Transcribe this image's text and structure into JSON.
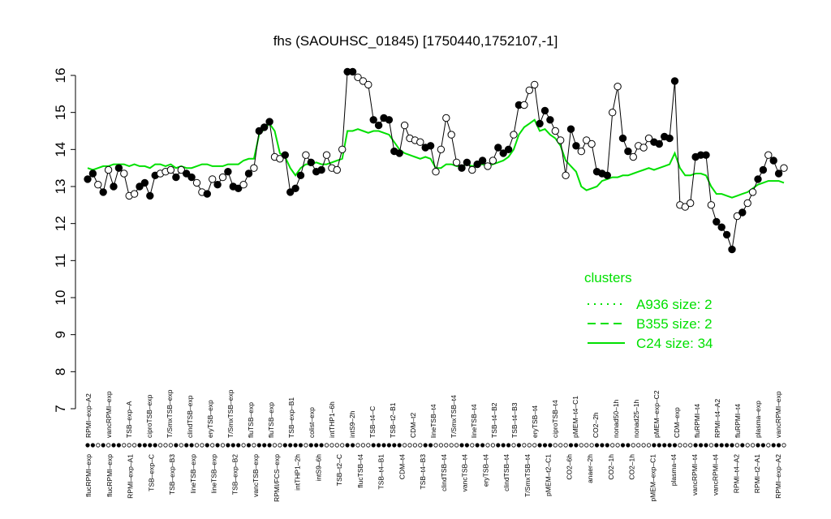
{
  "chart_data": {
    "type": "line",
    "title": "fhs (SAOUHSC_01845) [1750440,1752107,-1]",
    "xlabel": "",
    "ylabel": "",
    "ylim": [
      7,
      16
    ],
    "yticks": [
      7,
      8,
      9,
      10,
      11,
      12,
      13,
      14,
      15,
      16
    ],
    "x_labels_top": [
      "RPMI–exp–A2",
      "vancRPMI–exp",
      "TSB–exp–A",
      "ciproTSB–exp",
      "T/SmxTSB–exp",
      "clindTSB–exp",
      "eryTSB–exp",
      "T/SmxTSB–exp",
      "fluTSB–exp",
      "fluTSB–exp",
      "TSB–exp–B1",
      "colist–exp",
      "intTHP1–6h",
      "intS9–2h",
      "TSB–t4–C",
      "TSB–t2–B1",
      "CDM–t2",
      "lineTSB–t4",
      "T/SmxTSB–t4",
      "lineTSB–t4",
      "TSB–t4–B2",
      "TSB–t4–B3",
      "eryTSB–t4",
      "ciproTSB–t4",
      "pMEM–t4–C1",
      "CO2–2h",
      "nonad50–1h",
      "nonad25–1h",
      "pMEM–exp–C2",
      "CDM–exp",
      "fluRPMI–t4",
      "RPMI–t4–A2",
      "fluRPMI–t4",
      "plasma–exp",
      "vancRPMI–exp"
    ],
    "x_labels_bottom": [
      "flucRPMI–exp",
      "flucRPMI–exp",
      "RPMI–exp–A1",
      "TSB–exp–C",
      "TSB–exp–B3",
      "lineTSB–exp",
      "lineTSB–exp",
      "TSB–exp–B2",
      "vancTSB–exp",
      "RPMI/FCS–exp",
      "intTHP1–2h",
      "intS9–6h",
      "TSB–t2–C",
      "flucTSB–t4",
      "TSB–t4–B1",
      "CDM–t4",
      "TSB–t4–B3",
      "clindTSB–t4",
      "vancTSB–t4",
      "eryTSB–t4",
      "clindTSB–t4",
      "T/SmxTSB–t4",
      "pMEM–t2–C1",
      "CO2–6h",
      "anaer–2h",
      "CO2–1h",
      "CO2–1h",
      "pMEM–exp–C1",
      "plasma–t4",
      "vancRPMI–t4",
      "vancRPMI–t4",
      "RPMI–t4–A2",
      "RPMI–t2–A1",
      "RPMI–exp–A2"
    ],
    "values": [
      13.2,
      13.35,
      13.05,
      12.85,
      13.45,
      13.0,
      13.5,
      13.35,
      12.75,
      12.8,
      13.0,
      13.1,
      12.75,
      13.3,
      13.35,
      13.4,
      13.45,
      13.25,
      13.45,
      13.35,
      13.25,
      13.1,
      12.85,
      12.8,
      13.2,
      13.05,
      13.25,
      13.4,
      13.0,
      12.95,
      13.05,
      13.35,
      13.5,
      14.5,
      14.6,
      14.75,
      13.8,
      13.75,
      13.85,
      12.85,
      12.95,
      13.3,
      13.85,
      13.65,
      13.4,
      13.45,
      13.85,
      13.5,
      13.45,
      14.0,
      16.1,
      16.1,
      15.95,
      15.85,
      15.75,
      14.8,
      14.65,
      14.85,
      14.8,
      13.95,
      13.9,
      14.65,
      14.3,
      14.25,
      14.2,
      14.05,
      14.1,
      13.4,
      14.0,
      14.85,
      14.4,
      13.65,
      13.5,
      13.65,
      13.45,
      13.6,
      13.7,
      13.55,
      13.7,
      14.05,
      13.9,
      14.0,
      14.4,
      15.2,
      15.2,
      15.6,
      15.75,
      14.7,
      15.05,
      14.8,
      14.5,
      14.25,
      13.3,
      14.55,
      14.1,
      13.95,
      14.25,
      14.15,
      13.4,
      13.35,
      13.3,
      15.0,
      15.7,
      14.3,
      13.95,
      13.8,
      14.1,
      14.05,
      14.3,
      14.2,
      14.15,
      14.35,
      14.3,
      15.85,
      12.5,
      12.45,
      12.55,
      13.8,
      13.85,
      13.85,
      12.5,
      12.05,
      11.9,
      11.7,
      11.3,
      12.2,
      12.3,
      12.55,
      12.85,
      13.2,
      13.45,
      13.85,
      13.7,
      13.35,
      13.5
    ],
    "filled": [
      1,
      1,
      0,
      1,
      0,
      1,
      1,
      0,
      0,
      0,
      1,
      1,
      1,
      1,
      0,
      0,
      0,
      1,
      0,
      1,
      1,
      0,
      0,
      1,
      0,
      1,
      0,
      1,
      1,
      1,
      0,
      1,
      0,
      1,
      1,
      1,
      0,
      0,
      1,
      1,
      1,
      1,
      0,
      1,
      1,
      1,
      0,
      0,
      0,
      0,
      1,
      1,
      0,
      0,
      0,
      1,
      1,
      1,
      1,
      1,
      1,
      0,
      0,
      0,
      0,
      1,
      1,
      0,
      0,
      0,
      0,
      0,
      1,
      1,
      0,
      1,
      1,
      0,
      0,
      1,
      1,
      1,
      0,
      1,
      0,
      0,
      0,
      1,
      1,
      1,
      0,
      0,
      0,
      1,
      1,
      0,
      0,
      0,
      1,
      1,
      1,
      0,
      0,
      1,
      1,
      0,
      0,
      0,
      0,
      1,
      1,
      1,
      1,
      1,
      0,
      0,
      0,
      1,
      1,
      1,
      0,
      1,
      1,
      1,
      1,
      0,
      1,
      0,
      0,
      1,
      1,
      0,
      1,
      1,
      0
    ],
    "series": [
      {
        "name": "A936 size: 2",
        "style": "dotted"
      },
      {
        "name": "B355 size: 2",
        "style": "dashed"
      },
      {
        "name": "C24 size: 34",
        "style": "solid"
      }
    ],
    "cluster_line": [
      13.5,
      13.45,
      13.5,
      13.55,
      13.55,
      13.6,
      13.6,
      13.6,
      13.55,
      13.6,
      13.55,
      13.55,
      13.5,
      13.6,
      13.6,
      13.55,
      13.6,
      13.5,
      13.55,
      13.5,
      13.5,
      13.55,
      13.6,
      13.6,
      13.55,
      13.55,
      13.55,
      13.6,
      13.6,
      13.6,
      13.7,
      13.75,
      13.75,
      14.4,
      14.55,
      14.7,
      14.5,
      13.9,
      13.8,
      13.5,
      13.3,
      13.5,
      13.6,
      13.6,
      13.65,
      13.6,
      13.6,
      13.65,
      13.7,
      13.75,
      14.5,
      14.5,
      14.55,
      14.5,
      14.45,
      14.5,
      14.5,
      14.45,
      14.4,
      14.2,
      14.0,
      13.9,
      13.85,
      13.8,
      13.75,
      13.8,
      13.75,
      13.5,
      13.5,
      13.6,
      13.6,
      13.55,
      13.55,
      13.6,
      13.55,
      13.6,
      13.6,
      13.55,
      13.6,
      13.65,
      13.7,
      13.8,
      14.0,
      14.4,
      14.6,
      14.7,
      14.8,
      14.5,
      14.55,
      14.4,
      14.3,
      14.1,
      13.7,
      13.55,
      13.4,
      13.0,
      12.9,
      12.95,
      13.0,
      13.15,
      13.2,
      13.25,
      13.25,
      13.3,
      13.3,
      13.35,
      13.4,
      13.45,
      13.5,
      13.45,
      13.5,
      13.55,
      13.6,
      13.9,
      13.5,
      13.3,
      13.3,
      13.35,
      13.35,
      13.3,
      13.0,
      12.8,
      12.8,
      12.75,
      12.7,
      12.75,
      12.8,
      12.85,
      12.95,
      13.05,
      13.1,
      13.15,
      13.15,
      13.15,
      13.1
    ],
    "legend": {
      "title": "clusters",
      "placement": "right"
    },
    "colors": {
      "cluster": "#00e000",
      "points": "#000000",
      "axis": "#000000"
    }
  }
}
